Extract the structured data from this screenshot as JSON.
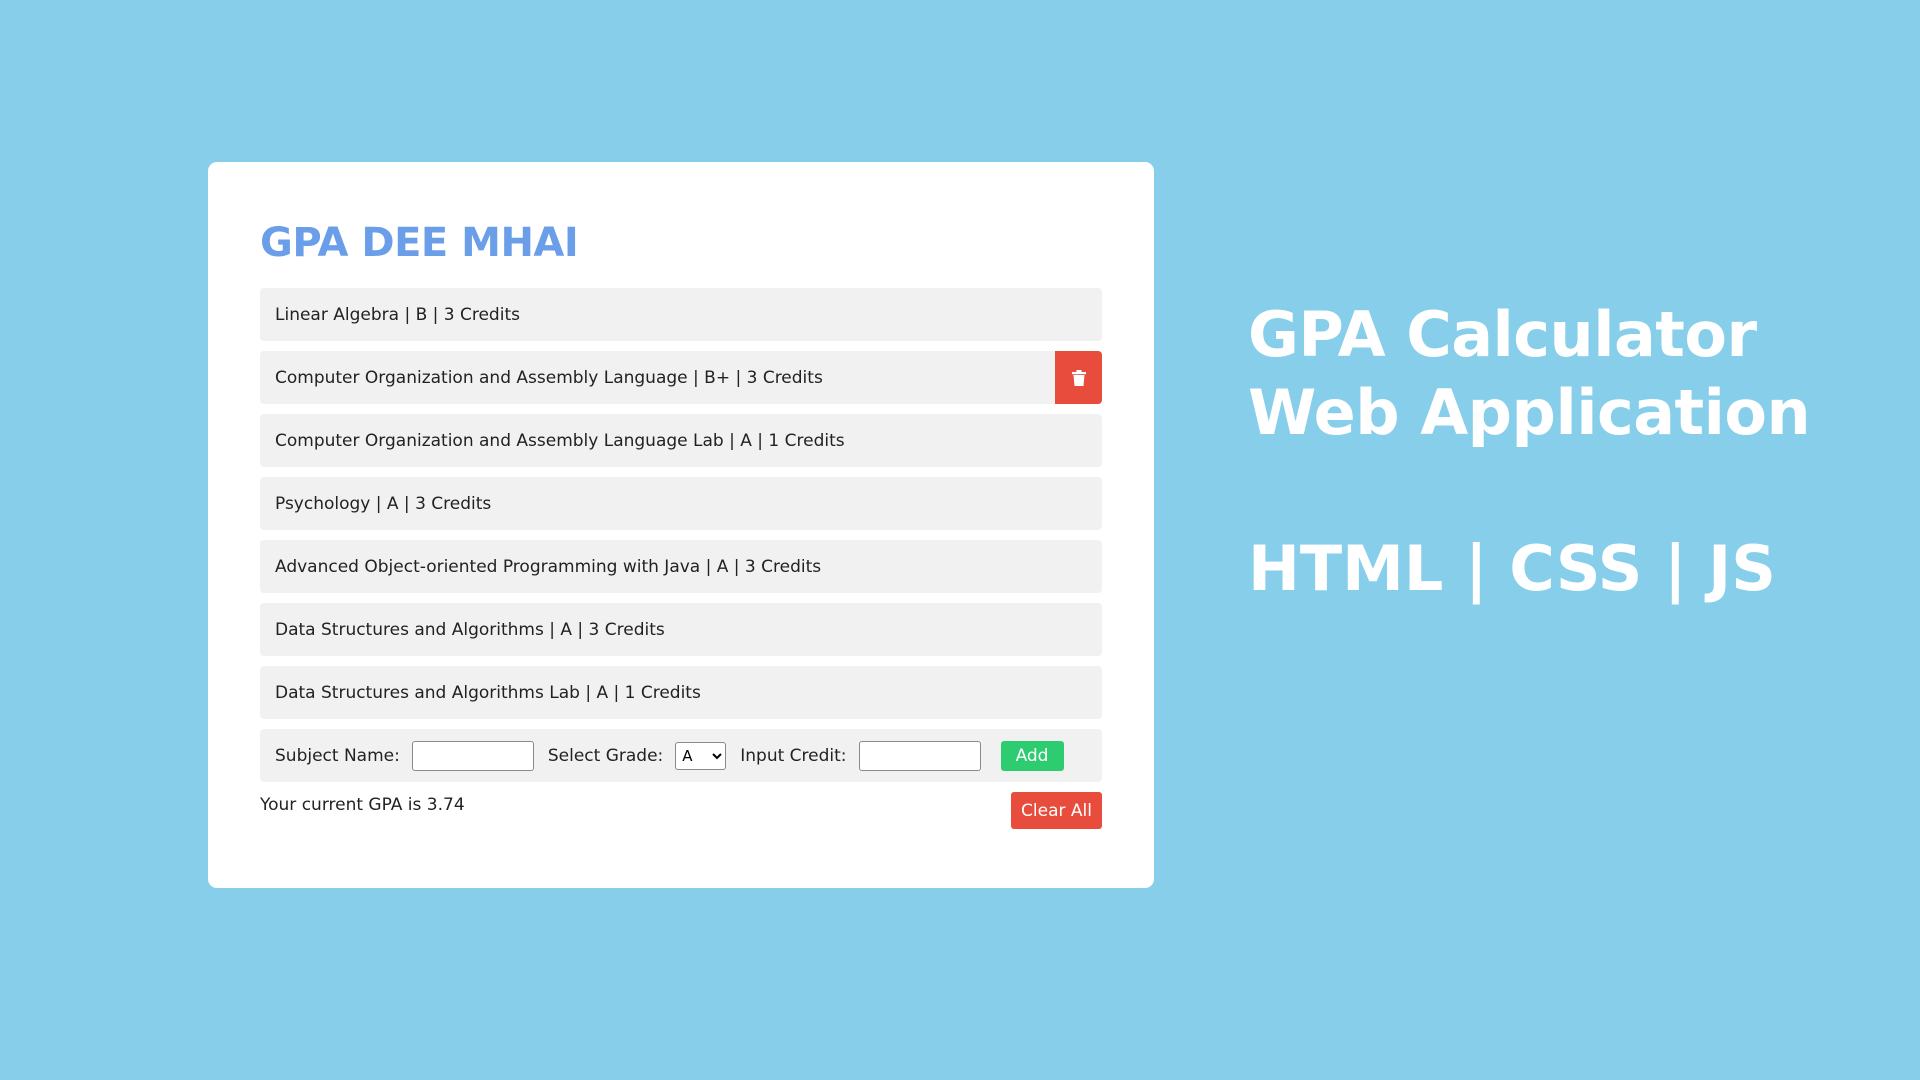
{
  "app": {
    "title": "GPA DEE MHAI"
  },
  "subjects": [
    {
      "label": "Linear Algebra | B | 3 Credits"
    },
    {
      "label": "Computer Organization and Assembly Language | B+ | 3 Credits"
    },
    {
      "label": "Computer Organization and Assembly Language Lab | A | 1 Credits"
    },
    {
      "label": "Psychology | A | 3 Credits"
    },
    {
      "label": "Advanced Object-oriented Programming with Java | A | 3 Credits"
    },
    {
      "label": "Data Structures and Algorithms | A | 3 Credits"
    },
    {
      "label": "Data Structures and Algorithms Lab | A | 1 Credits"
    }
  ],
  "delete_icon": "trash-icon",
  "form": {
    "subject_label": "Subject Name:",
    "subject_value": "",
    "grade_label": "Select Grade:",
    "grade_selected": "A",
    "credit_label": "Input Credit:",
    "credit_value": "",
    "add_label": "Add"
  },
  "result": {
    "gpa_text": "Your current GPA is 3.74",
    "clear_label": "Clear All"
  },
  "side": {
    "line1": "GPA Calculator",
    "line2": "Web Application",
    "tech": "HTML | CSS | JS"
  },
  "colors": {
    "background": "#87ceeb",
    "title": "#6b9ee8",
    "delete": "#e74c3c",
    "add": "#2ecc71",
    "clear": "#e74c3c"
  }
}
